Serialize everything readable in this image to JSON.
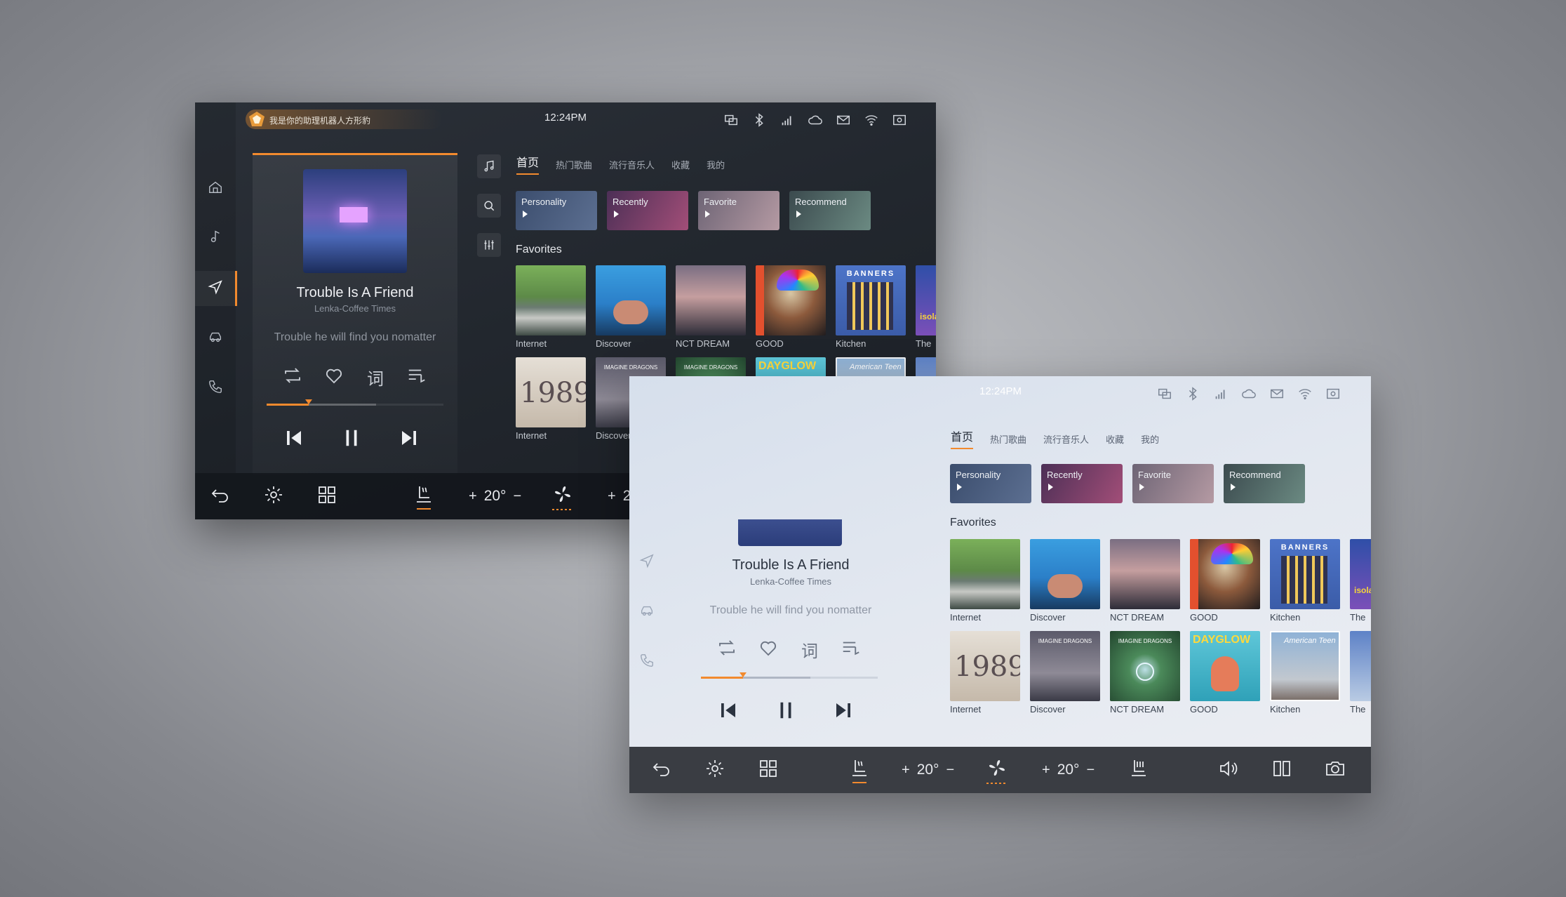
{
  "status": {
    "assistant_text": "我是你的助理机器人方形豹",
    "time": "12:24PM",
    "icons": [
      "screen-mirror-icon",
      "bluetooth-icon",
      "signal-icon",
      "cloud-icon",
      "mail-icon",
      "wifi-icon",
      "camera-box-icon"
    ]
  },
  "nav": {
    "icons": [
      "home-icon",
      "music-note-icon",
      "navigation-icon",
      "car-icon",
      "phone-icon"
    ],
    "active_index": 2
  },
  "tool_icons": [
    "music-library-icon",
    "search-icon",
    "equalizer-icon"
  ],
  "player": {
    "song": "Trouble Is A Friend",
    "artist": "Lenka-Coffee Times",
    "lyric": "Trouble  he will find you nomatter",
    "progress": 0.24,
    "buffered": 0.62,
    "actions": [
      "repeat-icon",
      "heart-icon",
      "lyrics-icon",
      "playlist-icon"
    ],
    "lyrics_glyph": "词"
  },
  "tabs": [
    "首页",
    "热门歌曲",
    "流行音乐人",
    "收藏",
    "我的"
  ],
  "cards": [
    {
      "label": "Personality",
      "color": "#4a5f80"
    },
    {
      "label": "Recently",
      "color": "#6b3a5e"
    },
    {
      "label": "Favorite",
      "color": "#8a7a8a"
    },
    {
      "label": "Recommend",
      "color": "#4e6a68"
    }
  ],
  "section_title": "Favorites",
  "albums_row1": [
    {
      "label": "Internet"
    },
    {
      "label": "Discover"
    },
    {
      "label": "NCT DREAM"
    },
    {
      "label": "GOOD"
    },
    {
      "label": "Kitchen"
    },
    {
      "label": "The"
    }
  ],
  "albums_row2": [
    {
      "label": "Internet"
    },
    {
      "label": "Discover"
    },
    {
      "label": "NCT DREAM"
    },
    {
      "label": "GOOD"
    },
    {
      "label": "Kitchen"
    },
    {
      "label": "The"
    }
  ],
  "album_texts": {
    "banners": "BANNERS",
    "y1989": "1989",
    "imagine": "IMAGINE DRAGONS",
    "dayglow": "DAYGLOW",
    "american_teen": "American Teen",
    "isola": "isola"
  },
  "bottom": {
    "temp_left": "20°",
    "temp_right": "20°",
    "plus": "+",
    "minus": "−"
  }
}
